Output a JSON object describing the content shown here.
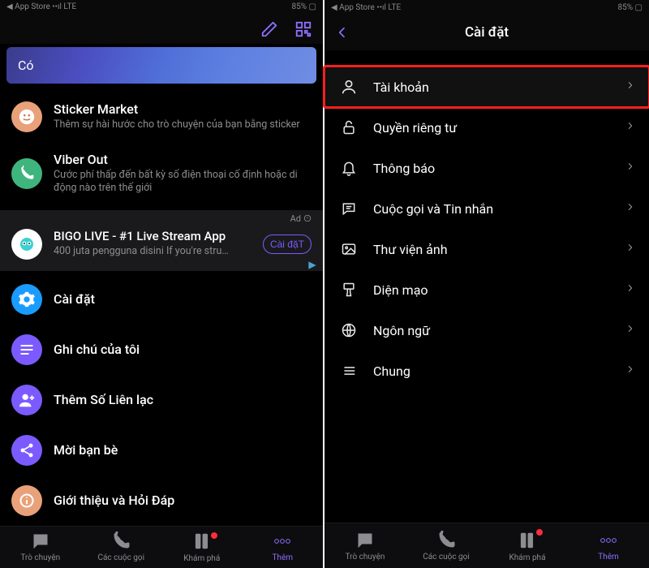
{
  "statusbar": {
    "carrier_left": "◀ App Store ••ıl LTE",
    "carrier_right": "◀ App Store ••ıl LTE",
    "right_left": "85% ▢",
    "right_right": "85% ▢"
  },
  "left": {
    "filter_label": "Có",
    "sticker": {
      "title": "Sticker Market",
      "sub": "Thêm sự hài hước cho trò chuyện của bạn bằng sticker"
    },
    "viberout": {
      "title": "Viber Out",
      "sub": "Cước phí thấp đến bất kỳ số điện thoại cố định hoặc di động nào trên thế giới"
    },
    "ad": {
      "badge": "Ad",
      "title": "BIGO LIVE - #1 Live Stream App",
      "sub": "400 juta pengguna disini If you're stru…",
      "install": "Cài đặT"
    },
    "menu": {
      "settings": "Cài đặt",
      "notes": "Ghi chú của tôi",
      "addcontact": "Thêm Số Liên lạc",
      "invite": "Mời bạn bè",
      "about": "Giới thiệu và Hỏi Đáp"
    }
  },
  "tabs": {
    "chats": "Trò chuyện",
    "calls": "Các cuộc gọi",
    "explore": "Khám phá",
    "more": "Thêm"
  },
  "right": {
    "title": "Cài đặt",
    "items": {
      "account": "Tài khoản",
      "privacy": "Quyền riêng tư",
      "notifications": "Thông báo",
      "calls": "Cuộc gọi và Tin nhắn",
      "media": "Thư viện ảnh",
      "appearance": "Diện mạo",
      "language": "Ngôn ngữ",
      "general": "Chung"
    }
  }
}
